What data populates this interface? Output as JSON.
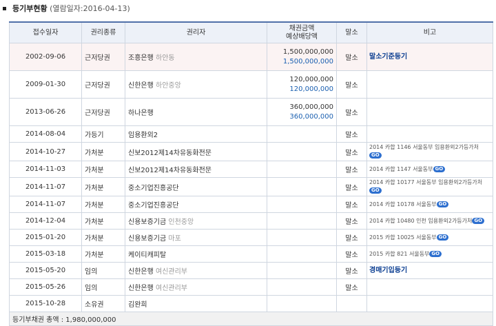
{
  "title": {
    "label": "등기부현황",
    "date": "(열람일자:2016-04-13)"
  },
  "headers": {
    "date": "접수일자",
    "type": "권리종류",
    "holder": "권리자",
    "amount_line1": "채권금액",
    "amount_line2": "예상배당액",
    "cancel": "말소",
    "note": "비고"
  },
  "rows": [
    {
      "date": "2002-09-06",
      "type": "근저당권",
      "holder": "조흥은행",
      "holder_sub": "하안동",
      "amount": "1,500,000,000",
      "dividend": "1,500,000,000",
      "cancel": "말소",
      "note": "말소기준등기",
      "note_link": true
    },
    {
      "date": "2009-01-30",
      "type": "근저당권",
      "holder": "신한은행",
      "holder_sub": "하안중앙",
      "amount": "120,000,000",
      "dividend": "120,000,000",
      "cancel": "말소",
      "note": ""
    },
    {
      "date": "2013-06-26",
      "type": "근저당권",
      "holder": "하나은행",
      "holder_sub": "",
      "amount": "360,000,000",
      "dividend": "360,000,000",
      "cancel": "말소",
      "note": ""
    },
    {
      "date": "2014-08-04",
      "type": "가등기",
      "holder": "임용환외2",
      "holder_sub": "",
      "amount": "",
      "dividend": "",
      "cancel": "말소",
      "note": ""
    },
    {
      "date": "2014-10-27",
      "type": "가처분",
      "holder": "신보2012제14차유동화전문",
      "holder_sub": "",
      "amount": "",
      "dividend": "",
      "cancel": "말소",
      "note": "2014 카합 1146 서울동부 임용환외2가등가처",
      "go": true
    },
    {
      "date": "2014-11-03",
      "type": "가처분",
      "holder": "신보2012제14차유동화전문",
      "holder_sub": "",
      "amount": "",
      "dividend": "",
      "cancel": "말소",
      "note": "2014 카합 1147 서울동부",
      "go": true
    },
    {
      "date": "2014-11-07",
      "type": "가처분",
      "holder": "중소기업진흥공단",
      "holder_sub": "",
      "amount": "",
      "dividend": "",
      "cancel": "말소",
      "note": "2014 카합 10177 서울동부 임용환외2가등가처",
      "go": true
    },
    {
      "date": "2014-11-07",
      "type": "가처분",
      "holder": "중소기업진흥공단",
      "holder_sub": "",
      "amount": "",
      "dividend": "",
      "cancel": "말소",
      "note": "2014 카합 10178 서울동부",
      "go": true
    },
    {
      "date": "2014-12-04",
      "type": "가처분",
      "holder": "신용보증기금",
      "holder_sub": "인천중앙",
      "amount": "",
      "dividend": "",
      "cancel": "말소",
      "note": "2014 카합 10480 인천 임용환외2가등가처",
      "go": true
    },
    {
      "date": "2015-01-20",
      "type": "가처분",
      "holder": "신용보증기금",
      "holder_sub": "마포",
      "amount": "",
      "dividend": "",
      "cancel": "말소",
      "note": "2015 카합 10025 서울동부",
      "go": true
    },
    {
      "date": "2015-03-18",
      "type": "가처분",
      "holder": "케이티캐피탈",
      "holder_sub": "",
      "amount": "",
      "dividend": "",
      "cancel": "말소",
      "note": "2015 카합 821 서울동부",
      "go": true
    },
    {
      "date": "2015-05-20",
      "type": "임의",
      "holder": "신한은행",
      "holder_sub": "여신관리부",
      "amount": "",
      "dividend": "",
      "cancel": "말소",
      "note": "경매기입등기",
      "note_link": true
    },
    {
      "date": "2015-05-26",
      "type": "임의",
      "holder": "신한은행",
      "holder_sub": "여신관리부",
      "amount": "",
      "dividend": "",
      "cancel": "말소",
      "note": ""
    },
    {
      "date": "2015-10-28",
      "type": "소유권",
      "holder": "김완희",
      "holder_sub": "",
      "amount": "",
      "dividend": "",
      "cancel": "",
      "note": ""
    }
  ],
  "total": {
    "label": "등기부채권 총액 : 1,980,000,000"
  },
  "go_label": "GO"
}
